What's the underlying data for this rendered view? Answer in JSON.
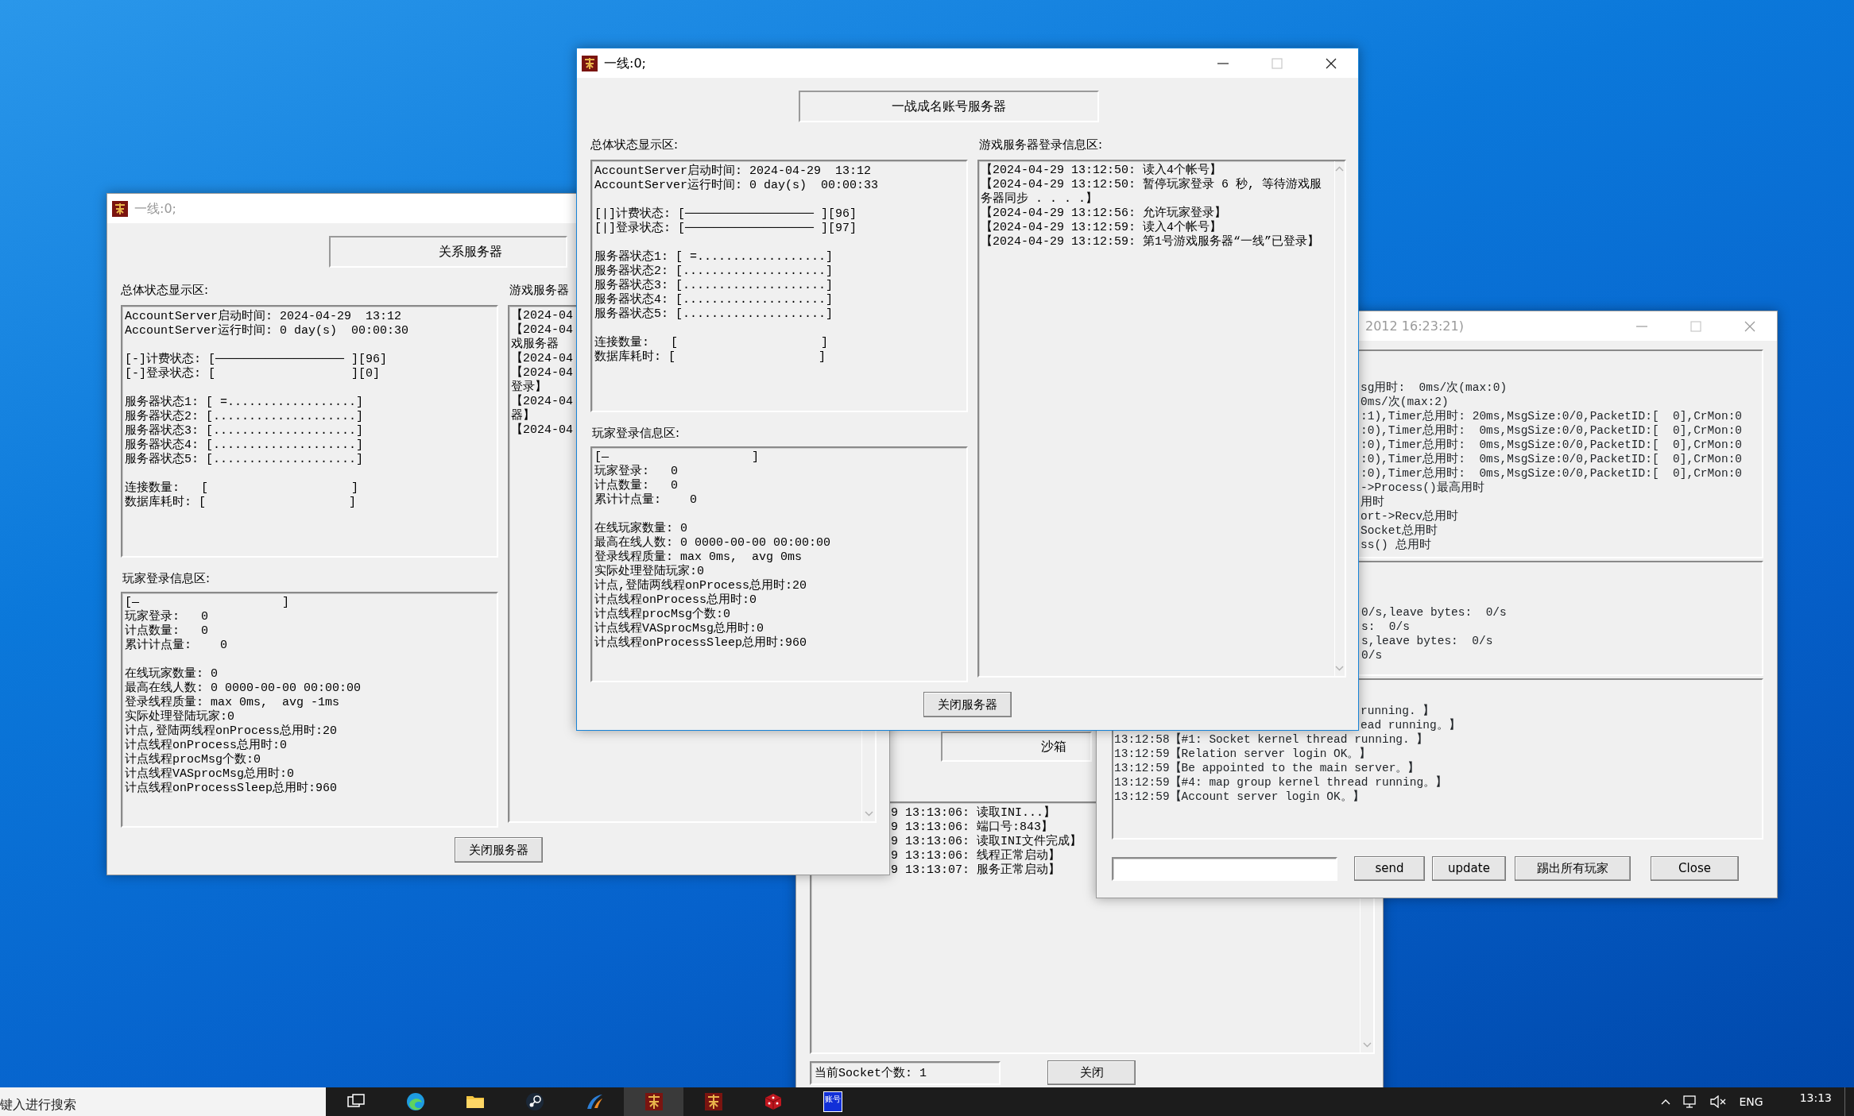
{
  "back_window": {
    "title": "一线:0;",
    "active": false,
    "header_button": "关系服务器",
    "status_label": "总体状态显示区:",
    "status_groups": [
      [
        "AccountServer启动时间: 2024-04-29  13:12",
        "AccountServer运行时间: 0 day(s)  00:00:30"
      ],
      [
        "[-]计费状态: [────────────────── ][96]",
        "[-]登录状态: [                   ][0]"
      ],
      [
        "服务器状态1: [ =..................]",
        "服务器状态2: [....................]",
        "服务器状态3: [....................]",
        "服务器状态4: [....................]",
        "服务器状态5: [....................]"
      ],
      [
        "连接数量:   [                    ]",
        "数据库耗时: [                    ]"
      ]
    ],
    "login_label": "玩家登录信息区:",
    "login_groups": [
      [
        "[—                    ]",
        "玩家登录:   0",
        "计点数量:   0",
        "累计计点量:    0"
      ],
      [
        "在线玩家数量: 0",
        "最高在线人数: 0 0000-00-00 00:00:00",
        "登录线程质量: max 0ms,  avg -1ms",
        "实际处理登陆玩家:0",
        "计点,登陆两线程onProcess总用时:20",
        "计点线程onProcess总用时:0",
        "计点线程procMsg个数:0",
        "计点线程VASprocMsg总用时:0",
        "计点线程onProcessSleep总用时:960"
      ]
    ],
    "game_label": "游戏服务器",
    "game_lines": [
      "【2024-04",
      "【2024-04",
      "戏服务器",
      "【2024-04",
      "【2024-04",
      "登录】",
      "【2024-04",
      "器】",
      "【2024-04"
    ],
    "close_button": "关闭服务器"
  },
  "sandbox_window": {
    "header_button": "沙箱",
    "log_lines": [
      "9 13:13:06: 读取INI...】",
      "9 13:13:06: 端口号:843】",
      "9 13:13:06: 读取INI文件完成】",
      "9 13:13:06: 线程正常启动】",
      "9 13:13:07: 服务正常启动】"
    ],
    "socket_field": "当前Socket个数: 1",
    "close_button": "关闭"
  },
  "stats_window": {
    "title": "2012 16:23:21)",
    "active": false,
    "controls": [
      {
        "kind": "minimize",
        "disabled": false
      },
      {
        "kind": "maximize",
        "disabled": true
      },
      {
        "kind": "close",
        "disabled": false
      }
    ],
    "perf_lines": [
      "sg用时:  0ms/次(max:0)",
      "0ms/次(max:2)",
      ":1),Timer总用时: 20ms,MsgSize:0/0,PacketID:[  0],CrMon:0",
      ":0),Timer总用时:  0ms,MsgSize:0/0,PacketID:[  0],CrMon:0",
      ":0),Timer总用时:  0ms,MsgSize:0/0,PacketID:[  0],CrMon:0",
      ":0),Timer总用时:  0ms,MsgSize:0/0,PacketID:[  0],CrMon:0",
      ":0),Timer总用时:  0ms,MsgSize:0/0,PacketID:[  0],CrMon:0",
      "->Process()最高用时",
      "用时",
      "ort->Recv总用时",
      "Socket总用时",
      "ss() 总用时"
    ],
    "traffic_lines": [
      "0/s,leave bytes:  0/s",
      "s:  0/s",
      "s,leave bytes:  0/s",
      "0/s"
    ],
    "log_clipped_lines": [
      "running. 】",
      "ead running。】"
    ],
    "log_lines": [
      "13:12:58【#1: Socket kernel thread running. 】",
      "13:12:59【Relation server login OK。】",
      "13:12:59【Be appointed to the main server。】",
      "13:12:59【#4: map group kernel thread running。】",
      "13:12:59【Account server login OK。】"
    ],
    "buttons": [
      "send",
      "update",
      "踢出所有玩家",
      "Close"
    ]
  },
  "front_window": {
    "title": "一线:0;",
    "active": true,
    "controls": [
      {
        "kind": "minimize",
        "disabled": false
      },
      {
        "kind": "maximize",
        "disabled": true
      },
      {
        "kind": "close",
        "disabled": false
      }
    ],
    "header_button": "一战成名账号服务器",
    "status_label": "总体状态显示区:",
    "status_groups": [
      [
        "AccountServer启动时间: 2024-04-29  13:12",
        "AccountServer运行时间: 0 day(s)  00:00:33"
      ],
      [
        "[|]计费状态: [────────────────── ][96]",
        "[|]登录状态: [────────────────── ][97]"
      ],
      [
        "服务器状态1: [ =..................]",
        "服务器状态2: [....................]",
        "服务器状态3: [....................]",
        "服务器状态4: [....................]",
        "服务器状态5: [....................]"
      ],
      [
        "连接数量:   [                    ]",
        "数据库耗时: [                    ]"
      ]
    ],
    "login_label": "玩家登录信息区:",
    "login_groups": [
      [
        "[—                    ]",
        "玩家登录:   0",
        "计点数量:   0",
        "累计计点量:    0"
      ],
      [
        "在线玩家数量: 0",
        "最高在线人数: 0 0000-00-00 00:00:00",
        "登录线程质量: max 0ms,  avg 0ms",
        "实际处理登陆玩家:0",
        "计点,登陆两线程onProcess总用时:20",
        "计点线程onProcess总用时:0",
        "计点线程procMsg个数:0",
        "计点线程VASprocMsg总用时:0",
        "计点线程onProcessSleep总用时:960"
      ]
    ],
    "game_label": "游戏服务器登录信息区:",
    "game_lines": [
      "【2024-04-29 13:12:50: 读入4个帐号】",
      "【2024-04-29 13:12:50: 暂停玩家登录 6 秒, 等待游戏服务器同步 . . . .】",
      "【2024-04-29 13:12:56: 允许玩家登录】",
      "【2024-04-29 13:12:59: 读入4个帐号】",
      "【2024-04-29 13:12:59: 第1号游戏服务器“一线”已登录】"
    ],
    "close_button": "关闭服务器"
  },
  "taskbar": {
    "search": {
      "placeholder": "键入进行搜索"
    },
    "apps": [
      {
        "kind": "task-view",
        "active": false
      },
      {
        "kind": "edge",
        "active": false
      },
      {
        "kind": "folder",
        "active": false
      },
      {
        "kind": "steam",
        "active": false
      },
      {
        "kind": "swoosh",
        "active": false
      },
      {
        "kind": "game",
        "active": true
      },
      {
        "kind": "game",
        "active": false
      },
      {
        "kind": "dice",
        "active": false
      },
      {
        "kind": "account",
        "active": false,
        "label": "账号"
      }
    ],
    "language": "ENG",
    "time": "13:13"
  }
}
